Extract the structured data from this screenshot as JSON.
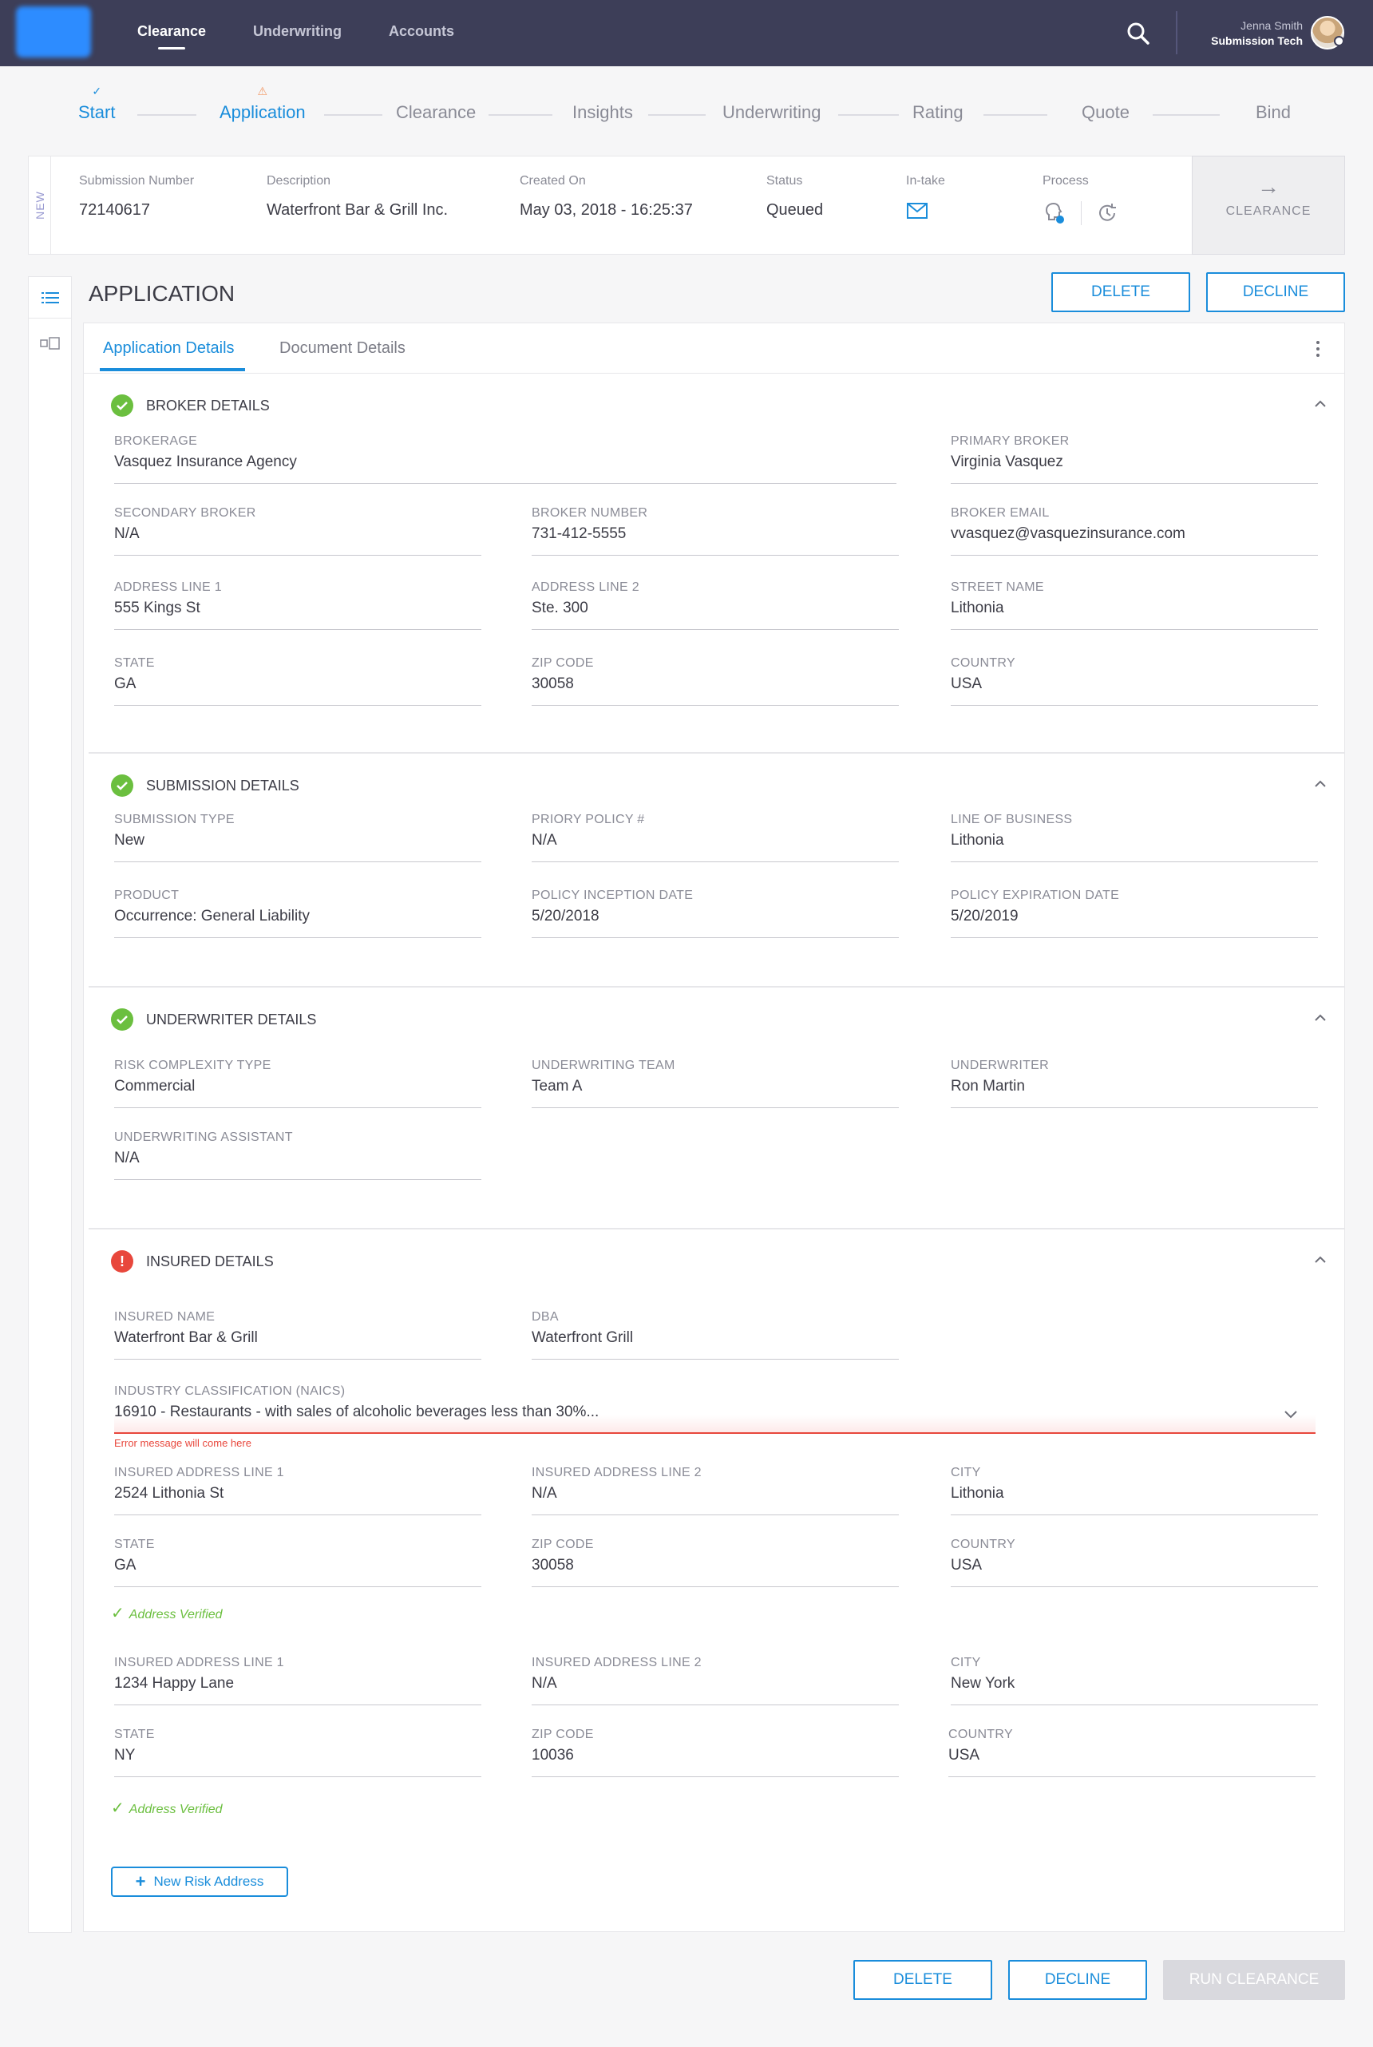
{
  "nav": {
    "links": [
      "Clearance",
      "Underwriting",
      "Accounts"
    ],
    "user_name": "Jenna Smith",
    "user_role": "Submission Tech"
  },
  "steps": [
    "Start",
    "Application",
    "Clearance",
    "Insights",
    "Underwriting",
    "Rating",
    "Quote",
    "Bind"
  ],
  "info": {
    "tag": "NEW",
    "submission_label": "Submission Number",
    "submission_value": "72140617",
    "description_label": "Description",
    "description_value": "Waterfront Bar & Grill Inc.",
    "created_label": "Created On",
    "created_value": "May 03, 2018 - 16:25:37",
    "status_label": "Status",
    "status_value": "Queued",
    "intake_label": "In-take",
    "process_label": "Process",
    "clearance_label": "CLEARANCE"
  },
  "page": {
    "title": "APPLICATION",
    "delete": "DELETE",
    "decline": "DECLINE",
    "run_clearance": "RUN CLEARANCE"
  },
  "tabs": [
    "Application Details",
    "Document Details"
  ],
  "broker": {
    "title": "BROKER DETAILS",
    "fields": [
      {
        "label": "BROKERAGE",
        "value": "Vasquez Insurance Agency"
      },
      {
        "label": "PRIMARY BROKER",
        "value": "Virginia Vasquez"
      },
      {
        "label": "SECONDARY BROKER",
        "value": "N/A"
      },
      {
        "label": "BROKER NUMBER",
        "value": "731-412-5555"
      },
      {
        "label": "BROKER EMAIL",
        "value": "vvasquez@vasquezinsurance.com"
      },
      {
        "label": "ADDRESS LINE 1",
        "value": "555 Kings St"
      },
      {
        "label": "ADDRESS LINE 2",
        "value": "Ste. 300"
      },
      {
        "label": "STREET NAME",
        "value": "Lithonia"
      },
      {
        "label": "STATE",
        "value": "GA"
      },
      {
        "label": "ZIP CODE",
        "value": "30058"
      },
      {
        "label": "COUNTRY",
        "value": "USA"
      }
    ]
  },
  "submission": {
    "title": "SUBMISSION DETAILS",
    "fields": [
      {
        "label": "SUBMISSION TYPE",
        "value": "New"
      },
      {
        "label": "PRIORY POLICY #",
        "value": "N/A"
      },
      {
        "label": "LINE OF BUSINESS",
        "value": "Lithonia"
      },
      {
        "label": "PRODUCT",
        "value": "Occurrence: General Liability"
      },
      {
        "label": "POLICY INCEPTION DATE",
        "value": "5/20/2018"
      },
      {
        "label": "POLICY EXPIRATION DATE",
        "value": "5/20/2019"
      }
    ]
  },
  "underwriter": {
    "title": "UNDERWRITER DETAILS",
    "fields": [
      {
        "label": "RISK COMPLEXITY TYPE",
        "value": "Commercial"
      },
      {
        "label": "UNDERWRITING TEAM",
        "value": "Team A"
      },
      {
        "label": "UNDERWRITER",
        "value": "Ron Martin"
      },
      {
        "label": "UNDERWRITING ASSISTANT",
        "value": "N/A"
      }
    ]
  },
  "insured": {
    "title": "INSURED DETAILS",
    "fields": [
      {
        "label": "INSURED NAME",
        "value": "Waterfront Bar & Grill"
      },
      {
        "label": "DBA",
        "value": "Waterfront Grill"
      },
      {
        "label": "INDUSTRY CLASSIFICATION (NAICS)",
        "value": "16910 - Restaurants - with sales of alcoholic beverages less than 30%..."
      },
      {
        "label": "INSURED ADDRESS LINE 1",
        "value": "2524 Lithonia St"
      },
      {
        "label": "INSURED ADDRESS LINE 2",
        "value": "N/A"
      },
      {
        "label": "CITY",
        "value": "Lithonia"
      },
      {
        "label": "STATE",
        "value": "GA"
      },
      {
        "label": "ZIP CODE",
        "value": "30058"
      },
      {
        "label": "COUNTRY",
        "value": "USA"
      },
      {
        "label": "INSURED ADDRESS LINE 1",
        "value": "1234 Happy Lane"
      },
      {
        "label": "INSURED ADDRESS LINE 2",
        "value": "N/A"
      },
      {
        "label": "CITY",
        "value": "New York"
      },
      {
        "label": "STATE",
        "value": "NY"
      },
      {
        "label": "ZIP CODE",
        "value": "10036"
      },
      {
        "label": "COUNTRY",
        "value": "USA"
      }
    ],
    "error": "Error message will come here",
    "verified": "Address Verified",
    "new_risk": "New Risk Address"
  },
  "colors": {
    "nav_bg": "#3d3e58",
    "accent": "#1a8ddb",
    "success": "#6bbf3f",
    "error": "#e8473c"
  }
}
